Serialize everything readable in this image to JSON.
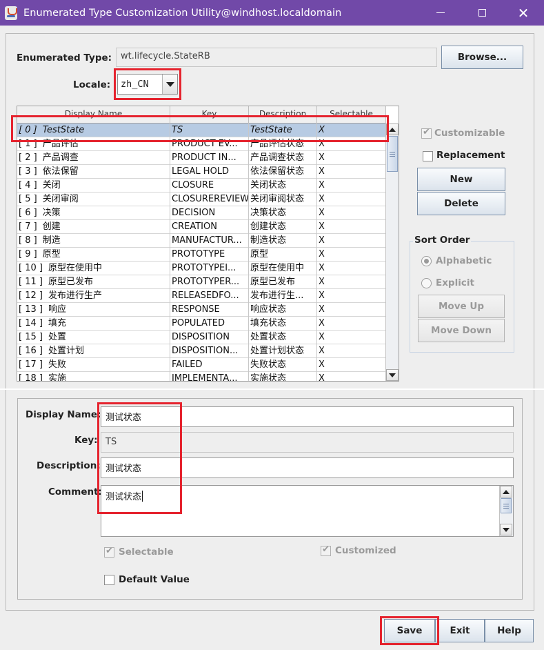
{
  "window": {
    "title": "Enumerated Type Customization Utility@windhost.localdomain"
  },
  "top": {
    "enum_type_label": "Enumerated Type:",
    "enum_type_value": "wt.lifecycle.StateRB",
    "browse_label": "Browse...",
    "locale_label": "Locale:",
    "locale_value": "zh_CN"
  },
  "table": {
    "columns": [
      "Display Name",
      "Key",
      "Description",
      "Selectable"
    ],
    "rows": [
      {
        "index": "[  0 ]",
        "display": "TestState",
        "key": "TS",
        "desc": "TestState",
        "sel": "X"
      },
      {
        "index": "[  1 ]",
        "display": "产品评估",
        "key": "PRODUCT EV...",
        "desc": "产品评估状态",
        "sel": "X"
      },
      {
        "index": "[  2 ]",
        "display": "产品调查",
        "key": "PRODUCT IN...",
        "desc": "产品调查状态",
        "sel": "X"
      },
      {
        "index": "[  3 ]",
        "display": "依法保留",
        "key": "LEGAL HOLD",
        "desc": "依法保留状态",
        "sel": "X"
      },
      {
        "index": "[  4 ]",
        "display": "关闭",
        "key": "CLOSURE",
        "desc": "关闭状态",
        "sel": "X"
      },
      {
        "index": "[  5 ]",
        "display": "关闭审阅",
        "key": "CLOSUREREVIEW",
        "desc": "关闭审阅状态",
        "sel": "X"
      },
      {
        "index": "[  6 ]",
        "display": "决策",
        "key": "DECISION",
        "desc": "决策状态",
        "sel": "X"
      },
      {
        "index": "[  7 ]",
        "display": "创建",
        "key": "CREATION",
        "desc": "创建状态",
        "sel": "X"
      },
      {
        "index": "[  8 ]",
        "display": "制造",
        "key": "MANUFACTUR...",
        "desc": "制造状态",
        "sel": "X"
      },
      {
        "index": "[  9 ]",
        "display": "原型",
        "key": "PROTOTYPE",
        "desc": "原型",
        "sel": "X"
      },
      {
        "index": "[ 10 ]",
        "display": "原型在使用中",
        "key": "PROTOTYPEI...",
        "desc": "原型在使用中",
        "sel": "X"
      },
      {
        "index": "[ 11 ]",
        "display": "原型已发布",
        "key": "PROTOTYPER...",
        "desc": "原型已发布",
        "sel": "X"
      },
      {
        "index": "[ 12 ]",
        "display": "发布进行生产",
        "key": "RELEASEDFO...",
        "desc": "发布进行生...",
        "sel": "X"
      },
      {
        "index": "[ 13 ]",
        "display": "响应",
        "key": "RESPONSE",
        "desc": "响应状态",
        "sel": "X"
      },
      {
        "index": "[ 14 ]",
        "display": "填充",
        "key": "POPULATED",
        "desc": "填充状态",
        "sel": "X"
      },
      {
        "index": "[ 15 ]",
        "display": "处置",
        "key": "DISPOSITION",
        "desc": "处置状态",
        "sel": "X"
      },
      {
        "index": "[ 16 ]",
        "display": "处置计划",
        "key": "DISPOSITION...",
        "desc": "处置计划状态",
        "sel": "X"
      },
      {
        "index": "[ 17 ]",
        "display": "失败",
        "key": "FAILED",
        "desc": "失败状态",
        "sel": "X"
      },
      {
        "index": "[ 18 ]",
        "display": "实施",
        "key": "IMPLEMENTA...",
        "desc": "实施状态",
        "sel": "X"
      }
    ]
  },
  "side": {
    "customizable_label": "Customizable",
    "replacement_label": "Replacement",
    "new_label": "New",
    "delete_label": "Delete",
    "sort_order_label": "Sort Order",
    "alphabetic_label": "Alphabetic",
    "explicit_label": "Explicit",
    "move_up_label": "Move Up",
    "move_down_label": "Move Down"
  },
  "detail": {
    "display_name_label": "Display Name:",
    "display_name_value": "测试状态",
    "key_label": "Key:",
    "key_value": "TS",
    "description_label": "Description:",
    "description_value": "测试状态",
    "comment_label": "Comment:",
    "comment_value": "测试状态",
    "selectable_label": "Selectable",
    "customized_label": "Customized",
    "default_value_label": "Default Value"
  },
  "footer": {
    "save_label": "Save",
    "exit_label": "Exit",
    "help_label": "Help"
  },
  "colors": {
    "titlebar": "#7149a8",
    "selection": "#b7cbe3",
    "highlight_box": "#e5232e"
  }
}
